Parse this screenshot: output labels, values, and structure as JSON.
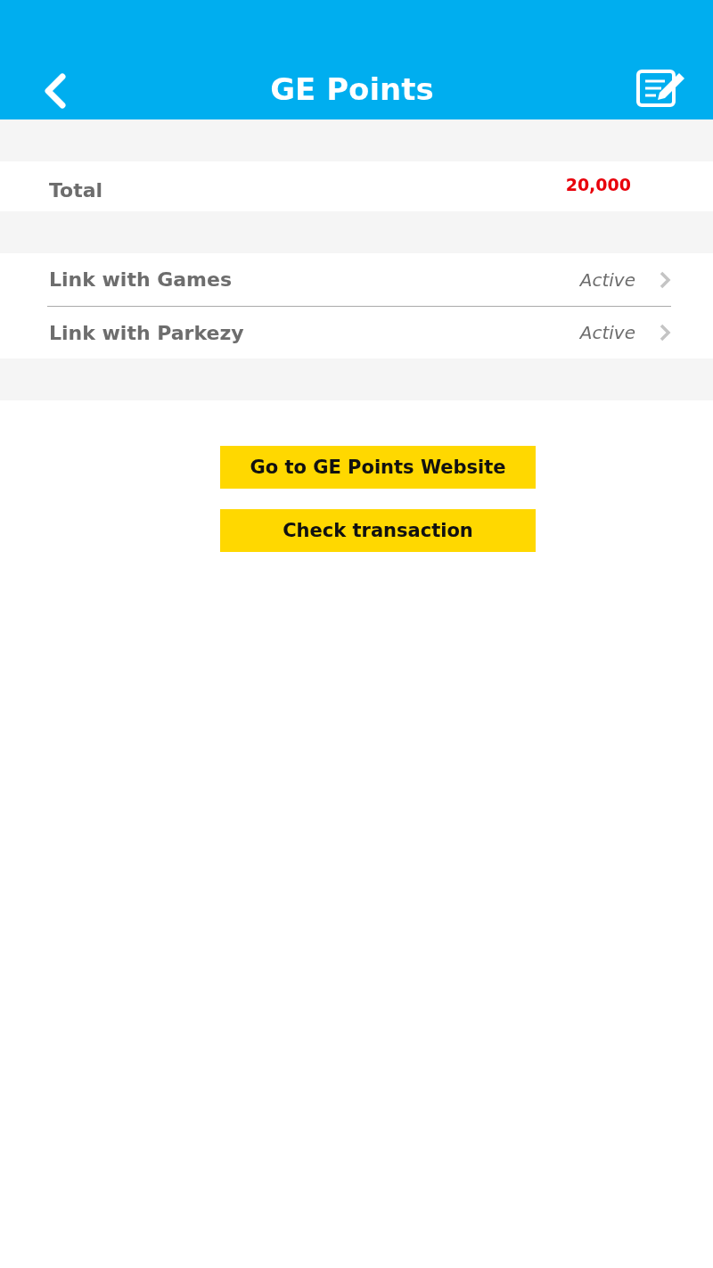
{
  "header": {
    "title": "GE Points"
  },
  "total": {
    "label": "Total",
    "value": "20,000"
  },
  "links": [
    {
      "label": "Link with Games",
      "status": "Active"
    },
    {
      "label": "Link with Parkezy",
      "status": "Active"
    }
  ],
  "buttons": [
    "Go to GE Points Website",
    "Check transaction"
  ]
}
